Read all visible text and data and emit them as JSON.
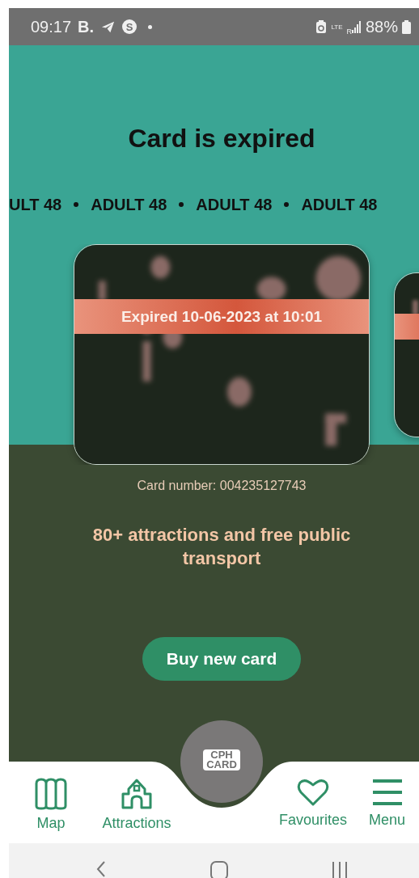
{
  "status_bar": {
    "time": "09:17",
    "apps": [
      {
        "kind": "text",
        "label": "B."
      },
      {
        "kind": "telegram"
      },
      {
        "kind": "skype",
        "label": "S"
      },
      {
        "kind": "dot"
      }
    ],
    "network": "LTE",
    "roaming": "R",
    "battery": "88%"
  },
  "title": "Card is expired",
  "card_types": [
    "ULT 48",
    "ADULT 48",
    "ADULT 48",
    "ADULT 48"
  ],
  "cards": [
    {
      "expired": true,
      "banner": "Expired 10-06-2023 at 10:01"
    },
    {
      "expired": true
    }
  ],
  "card_number": "Card number: 004235127743",
  "tagline": "80+ attractions and free public transport",
  "buy_button": "Buy new card",
  "center_button": {
    "lines": [
      "CPH",
      "CARD"
    ]
  },
  "nav": [
    {
      "kind": "map",
      "label": "Map"
    },
    {
      "kind": "attractions",
      "label": "Attractions"
    },
    {
      "kind": "spacer"
    },
    {
      "kind": "favourites",
      "label": "Favourites"
    },
    {
      "kind": "menu",
      "label": "Menu"
    }
  ]
}
